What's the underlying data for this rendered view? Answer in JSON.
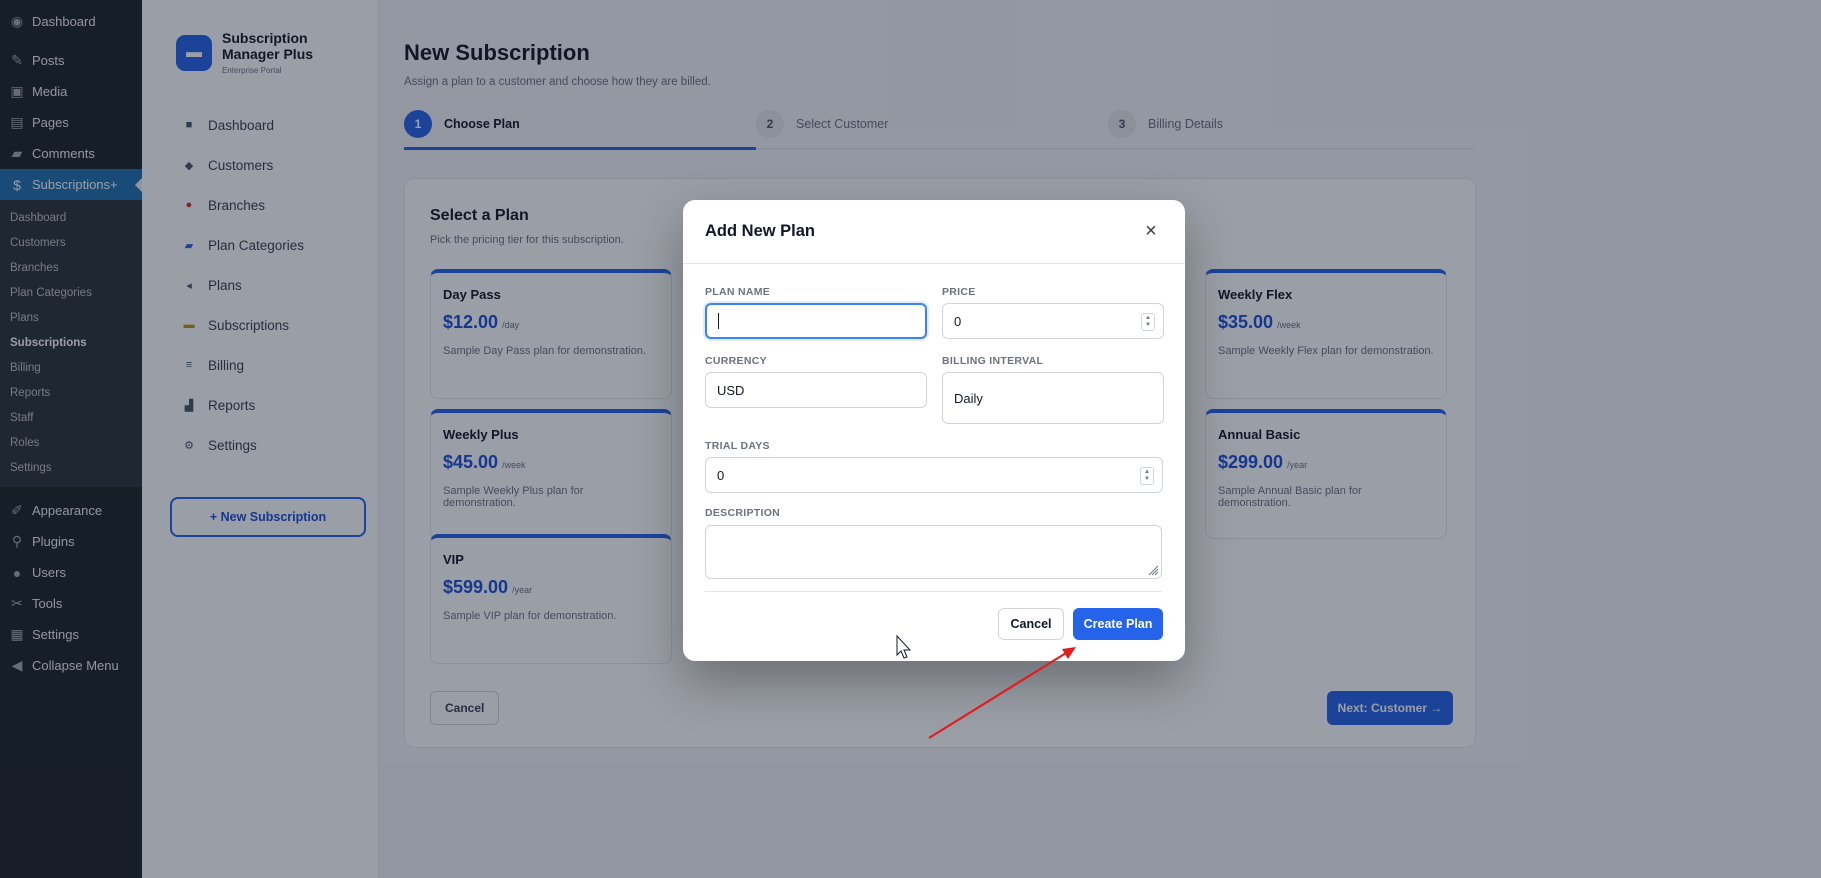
{
  "wp_menu": {
    "top_items": [
      {
        "label": "Dashboard",
        "icon": "dashboard-icon"
      },
      {
        "label": "Posts",
        "icon": "pin-icon"
      },
      {
        "label": "Media",
        "icon": "media-icon"
      },
      {
        "label": "Pages",
        "icon": "pages-icon"
      },
      {
        "label": "Comments",
        "icon": "comments-icon"
      },
      {
        "label": "Subscriptions+",
        "icon": "dollar-icon"
      }
    ],
    "sub_items": [
      "Dashboard",
      "Customers",
      "Branches",
      "Plan Categories",
      "Plans",
      "Subscriptions",
      "Billing",
      "Reports",
      "Staff",
      "Roles",
      "Settings"
    ],
    "bottom_items": [
      {
        "label": "Appearance",
        "icon": "brush-icon"
      },
      {
        "label": "Plugins",
        "icon": "plugin-icon"
      },
      {
        "label": "Users",
        "icon": "users-icon"
      },
      {
        "label": "Tools",
        "icon": "wrench-icon"
      },
      {
        "label": "Settings",
        "icon": "settings-icon"
      },
      {
        "label": "Collapse Menu",
        "icon": "collapse-icon"
      }
    ]
  },
  "brand": {
    "title": "Subscription Manager Plus",
    "subtitle": "Enterprise Portal"
  },
  "plugin_nav": {
    "items": [
      {
        "label": "Dashboard",
        "icon": "grid-icon"
      },
      {
        "label": "Customers",
        "icon": "customers-icon"
      },
      {
        "label": "Branches",
        "icon": "map-pin-icon"
      },
      {
        "label": "Plan Categories",
        "icon": "folder-icon"
      },
      {
        "label": "Plans",
        "icon": "tag-icon"
      },
      {
        "label": "Subscriptions",
        "icon": "card-icon"
      },
      {
        "label": "Billing",
        "icon": "receipt-icon"
      },
      {
        "label": "Reports",
        "icon": "chart-icon"
      },
      {
        "label": "Settings",
        "icon": "gear-icon"
      }
    ],
    "new_subscription_label": "+ New Subscription"
  },
  "page": {
    "title": "New Subscription",
    "subtitle": "Assign a plan to a customer and choose how they are billed.",
    "steps": [
      {
        "num": "1",
        "label": "Choose Plan"
      },
      {
        "num": "2",
        "label": "Select Customer"
      },
      {
        "num": "3",
        "label": "Billing Details"
      }
    ]
  },
  "plans_panel": {
    "title": "Select a Plan",
    "subtitle": "Pick the pricing tier for this subscription.",
    "plans": [
      {
        "name": "Day Pass",
        "price": "$12.00",
        "per": "/day",
        "desc": "Sample Day Pass plan for demonstration."
      },
      {
        "name": "Weekly Flex",
        "price": "$35.00",
        "per": "/week",
        "desc": "Sample Weekly Flex plan for demonstration."
      },
      {
        "name": "Weekly Plus",
        "price": "$45.00",
        "per": "/week",
        "desc": "Sample Weekly Plus plan for demonstration."
      },
      {
        "name": "Annual Basic",
        "price": "$299.00",
        "per": "/year",
        "desc": "Sample Annual Basic plan for demonstration."
      },
      {
        "name": "VIP",
        "price": "$599.00",
        "per": "/year",
        "desc": "Sample VIP plan for demonstration."
      }
    ],
    "cancel_label": "Cancel",
    "next_label": "Next: Customer →"
  },
  "modal": {
    "title": "Add New Plan",
    "close_icon": "×",
    "fields": {
      "plan_name_label": "PLAN NAME",
      "plan_name_value": "",
      "price_label": "PRICE",
      "price_value": "0",
      "currency_label": "CURRENCY",
      "currency_value": "USD",
      "billing_interval_label": "BILLING INTERVAL",
      "billing_interval_value": "Daily",
      "trial_days_label": "TRIAL DAYS",
      "trial_days_value": "0",
      "description_label": "DESCRIPTION",
      "description_value": ""
    },
    "cancel_label": "Cancel",
    "create_label": "Create Plan"
  },
  "colors": {
    "accent": "#2563eb",
    "wp_sidebar": "#1d2327",
    "annotation_arrow": "#e11d1d"
  }
}
